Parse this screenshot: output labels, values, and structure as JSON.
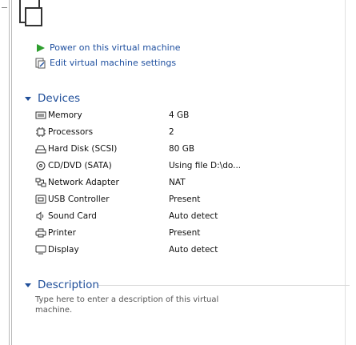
{
  "actions": [
    {
      "label": "Power on this virtual machine",
      "icon": "play-icon"
    },
    {
      "label": "Edit virtual machine settings",
      "icon": "edit-settings-icon"
    }
  ],
  "devices": {
    "title": "Devices",
    "items": [
      {
        "name": "Memory",
        "value": "4 GB",
        "icon": "memory-icon"
      },
      {
        "name": "Processors",
        "value": "2",
        "icon": "processor-icon"
      },
      {
        "name": "Hard Disk (SCSI)",
        "value": "80 GB",
        "icon": "hard-disk-icon"
      },
      {
        "name": "CD/DVD (SATA)",
        "value": "Using file D:\\do...",
        "icon": "cd-dvd-icon"
      },
      {
        "name": "Network Adapter",
        "value": "NAT",
        "icon": "network-adapter-icon"
      },
      {
        "name": "USB Controller",
        "value": "Present",
        "icon": "usb-controller-icon"
      },
      {
        "name": "Sound Card",
        "value": "Auto detect",
        "icon": "sound-card-icon"
      },
      {
        "name": "Printer",
        "value": "Present",
        "icon": "printer-icon"
      },
      {
        "name": "Display",
        "value": "Auto detect",
        "icon": "display-icon"
      }
    ]
  },
  "description": {
    "title": "Description",
    "placeholder": "Type here to enter a description of this virtual machine."
  },
  "colors": {
    "accent": "#1f4e99",
    "play": "#2e9e2e"
  }
}
